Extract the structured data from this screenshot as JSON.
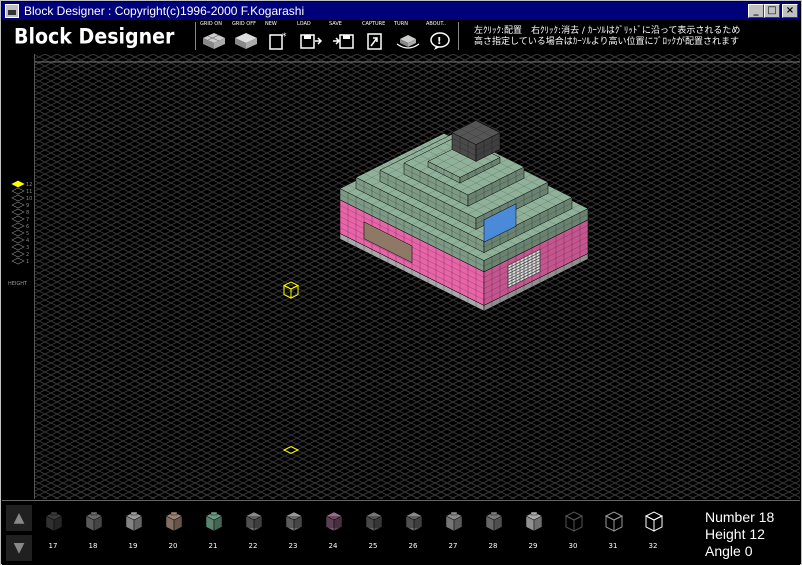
{
  "window": {
    "title": "Block Designer : Copyright(c)1996-2000 F.Kogarashi",
    "minimize_label": "_",
    "maximize_label": "□",
    "close_label": "×"
  },
  "toolbar": {
    "logo": "Block Designer",
    "buttons": [
      {
        "label": "GRID ON",
        "icon": "grid-on-icon"
      },
      {
        "label": "GRID OFF",
        "icon": "grid-off-icon"
      },
      {
        "label": "NEW",
        "icon": "new-icon"
      },
      {
        "label": "LOAD",
        "icon": "load-icon"
      },
      {
        "label": "SAVE",
        "icon": "save-icon"
      },
      {
        "label": "CAPTURE",
        "icon": "capture-icon"
      },
      {
        "label": "TURN",
        "icon": "turn-icon"
      },
      {
        "label": "ABOUT..",
        "icon": "about-icon"
      }
    ],
    "message_line1": "左ｸﾘｯｸ:配置　右ｸﾘｯｸ:消去 / ｶｰｿﾙはｸﾞﾘｯﾄﾞに沿って表示されるため",
    "message_line2": "高さ指定している場合はｶｰｿﾙより高い位置にﾌﾞﾛｯｸが配置されます"
  },
  "height_panel": {
    "label": "HEIGHT",
    "levels": [
      "12",
      "11",
      "10",
      "9",
      "8",
      "7",
      "6",
      "5",
      "4",
      "3",
      "2",
      "1"
    ],
    "selected": "12"
  },
  "palette": {
    "up_icon": "up-arrow-icon",
    "down_icon": "down-arrow-icon",
    "up_label": "▲",
    "down_label": "▼",
    "blocks": [
      {
        "num": "17",
        "color": "#3a3a3a",
        "style": "solid"
      },
      {
        "num": "18",
        "color": "#6a6a6a",
        "style": "solid"
      },
      {
        "num": "19",
        "color": "#9a9a9a",
        "style": "solid"
      },
      {
        "num": "20",
        "color": "#9b8272",
        "style": "solid"
      },
      {
        "num": "21",
        "color": "#6b9a80",
        "style": "solid"
      },
      {
        "num": "22",
        "color": "#888888",
        "style": "mesh"
      },
      {
        "num": "23",
        "color": "#999999",
        "style": "mesh"
      },
      {
        "num": "24",
        "color": "#9a6a8a",
        "style": "mesh"
      },
      {
        "num": "25",
        "color": "#777777",
        "style": "mesh"
      },
      {
        "num": "26",
        "color": "#888888",
        "style": "mesh"
      },
      {
        "num": "27",
        "color": "#8a8a8a",
        "style": "solid"
      },
      {
        "num": "28",
        "color": "#7a7a7a",
        "style": "solid"
      },
      {
        "num": "29",
        "color": "#aaaaaa",
        "style": "solid"
      },
      {
        "num": "30",
        "color": "#555555",
        "style": "outline"
      },
      {
        "num": "31",
        "color": "#999999",
        "style": "outline"
      },
      {
        "num": "32",
        "color": "#ffffff",
        "style": "outline"
      }
    ]
  },
  "status": {
    "number": "Number 18",
    "height": "Height 12",
    "angle": "Angle 0"
  },
  "colors": {
    "roof": "#7d9a85",
    "wall": "#e864a8",
    "base": "#a8a8a8",
    "blue_panel": "#4a8ad8",
    "brown_panel": "#8e7866",
    "chimney": "#4a4a4a",
    "cursor": "#ffff00",
    "grid": "#3a3a3a"
  }
}
